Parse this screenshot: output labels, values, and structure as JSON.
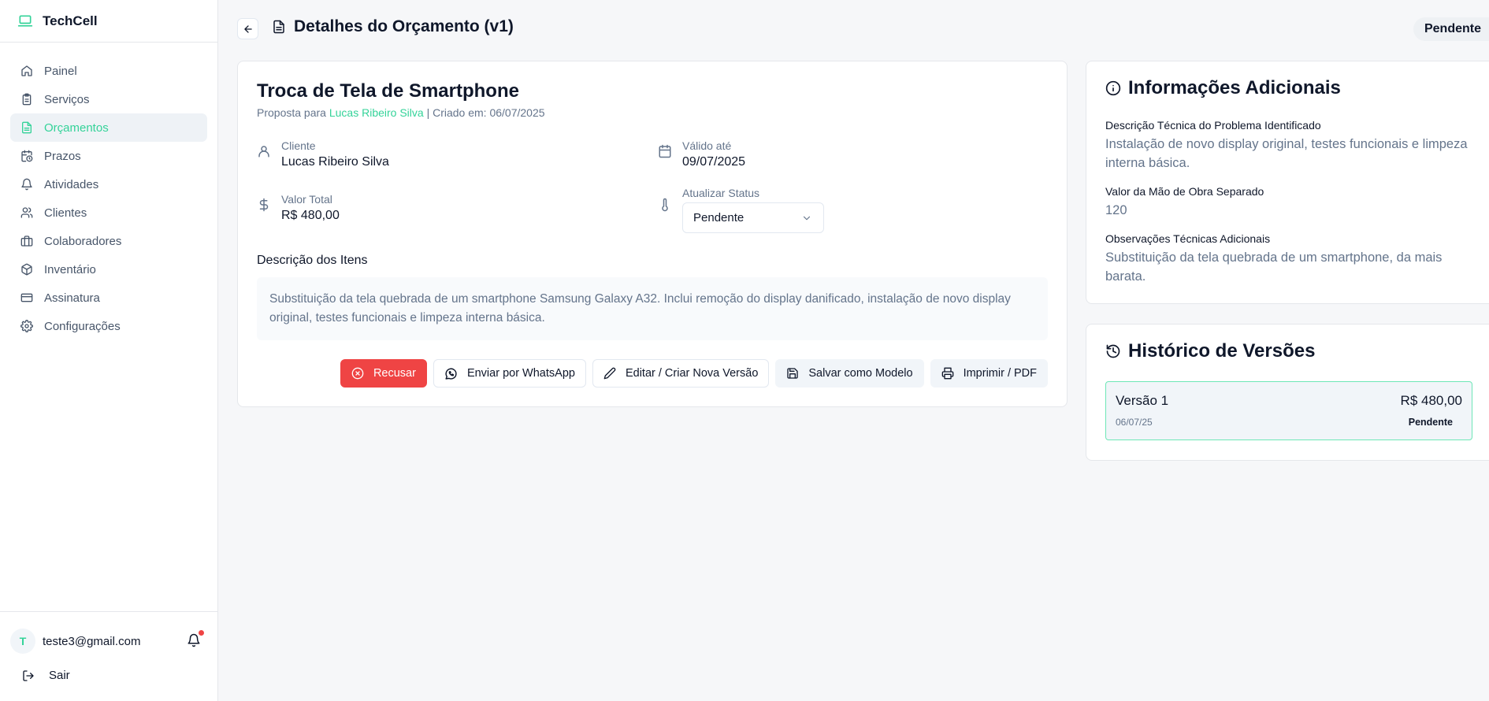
{
  "app": {
    "name": "TechCell"
  },
  "sidebar": {
    "items": [
      {
        "label": "Painel",
        "icon": "home-icon"
      },
      {
        "label": "Serviços",
        "icon": "clipboard-icon"
      },
      {
        "label": "Orçamentos",
        "icon": "file-text-icon",
        "active": true
      },
      {
        "label": "Prazos",
        "icon": "calendar-clock-icon"
      },
      {
        "label": "Atividades",
        "icon": "bell-icon"
      },
      {
        "label": "Clientes",
        "icon": "users-icon"
      },
      {
        "label": "Colaboradores",
        "icon": "briefcase-icon"
      },
      {
        "label": "Inventário",
        "icon": "package-icon"
      },
      {
        "label": "Assinatura",
        "icon": "credit-card-icon"
      },
      {
        "label": "Configurações",
        "icon": "gear-icon"
      }
    ],
    "user": {
      "initial": "T",
      "email": "teste3@gmail.com"
    },
    "logout_label": "Sair"
  },
  "header": {
    "title": "Detalhes do Orçamento (v1)",
    "status": "Pendente"
  },
  "quote": {
    "title": "Troca de Tela de Smartphone",
    "subtitle_prefix": "Proposta para",
    "client_link": "Lucas Ribeiro Silva",
    "subtitle_suffix": "| Criado em: 06/07/2025",
    "client_label": "Cliente",
    "client_value": "Lucas Ribeiro Silva",
    "valid_label": "Válido até",
    "valid_value": "09/07/2025",
    "total_label": "Valor Total",
    "total_value": "R$ 480,00",
    "status_label": "Atualizar Status",
    "status_value": "Pendente",
    "items_title": "Descrição dos Itens",
    "items_text": "Substituição da tela quebrada de um smartphone Samsung Galaxy A32. Inclui remoção do display danificado, instalação de novo display original, testes funcionais e limpeza interna básica."
  },
  "actions": {
    "refuse": "Recusar",
    "whatsapp": "Enviar por WhatsApp",
    "edit": "Editar / Criar Nova Versão",
    "save_template": "Salvar como Modelo",
    "print": "Imprimir / PDF"
  },
  "additional_info": {
    "title": "Informações Adicionais",
    "tech_desc_label": "Descrição Técnica do Problema Identificado",
    "tech_desc_value": "Instalação de novo display original, testes funcionais e limpeza interna básica.",
    "labor_label": "Valor da Mão de Obra Separado",
    "labor_value": "120",
    "notes_label": "Observações Técnicas Adicionais",
    "notes_value": "Substituição da tela quebrada de um smartphone, da mais barata."
  },
  "history": {
    "title": "Histórico de Versões",
    "versions": [
      {
        "name": "Versão 1",
        "price": "R$ 480,00",
        "date": "06/07/25",
        "status": "Pendente"
      }
    ]
  },
  "colors": {
    "accent": "#34d399",
    "danger": "#ef4444",
    "text": "#0f172a",
    "muted": "#64748b"
  }
}
